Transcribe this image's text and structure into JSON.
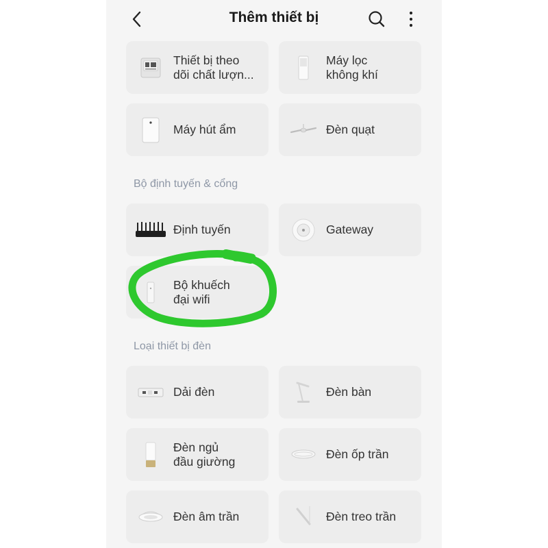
{
  "header": {
    "title": "Thêm thiết bị",
    "back_icon": "chevron-left-icon",
    "search_icon": "search-icon",
    "more_icon": "more-vertical-icon"
  },
  "sections": [
    {
      "title": "",
      "items": [
        {
          "label": "Thiết bị theo\ndõi chất lượn...",
          "icon": "air-quality-monitor-icon"
        },
        {
          "label": "Máy lọc\nkhông khí",
          "icon": "air-purifier-icon"
        },
        {
          "label": "Máy hút ẩm",
          "icon": "dehumidifier-icon"
        },
        {
          "label": "Đèn quạt",
          "icon": "ceiling-fan-light-icon"
        }
      ]
    },
    {
      "title": "Bộ định tuyến & cổng",
      "items": [
        {
          "label": "Định tuyến",
          "icon": "router-icon"
        },
        {
          "label": "Gateway",
          "icon": "gateway-icon"
        },
        {
          "label": "Bộ khuếch\nđại wifi",
          "icon": "wifi-extender-icon"
        }
      ]
    },
    {
      "title": "Loại thiết bị đèn",
      "items": [
        {
          "label": "Dải đèn",
          "icon": "light-strip-icon"
        },
        {
          "label": "Đèn bàn",
          "icon": "desk-lamp-icon"
        },
        {
          "label": "Đèn ngủ\nđầu giường",
          "icon": "bedside-lamp-icon"
        },
        {
          "label": "Đèn ốp trần",
          "icon": "ceiling-light-icon"
        },
        {
          "label": "Đèn âm trần",
          "icon": "downlight-icon"
        },
        {
          "label": "Đèn treo trần",
          "icon": "pendant-light-icon"
        }
      ]
    }
  ],
  "annotation": {
    "color": "#2ec82e",
    "target": "Bộ khuếch đại wifi"
  }
}
